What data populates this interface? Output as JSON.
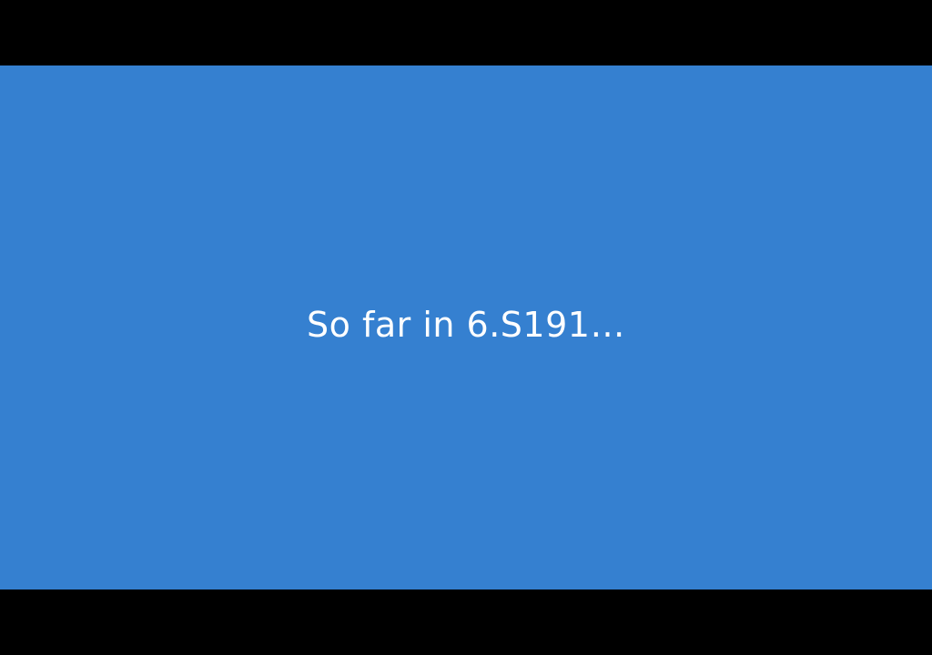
{
  "slide": {
    "title": "So far in 6.S191…",
    "background_color": "#3580d0",
    "text_color": "#ffffff",
    "letterbox_color": "#000000"
  }
}
